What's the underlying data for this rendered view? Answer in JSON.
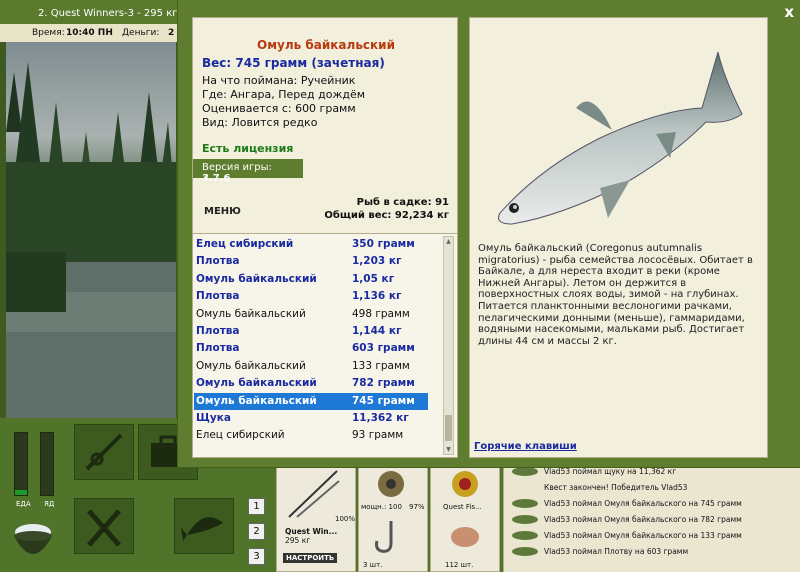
{
  "top_bar": {
    "quest_title": "2. Quest Winners-3 - 295 кг",
    "time_label": "Время:",
    "time_value": "10:40 ПН",
    "money_label": "Деньги:",
    "money_value": "2"
  },
  "gauges": {
    "food_label": "ЕДА",
    "food_level": 0.08,
    "poison_label": "ЯД",
    "poison_level": 0.0
  },
  "side_buttons": [
    "1",
    "2",
    "3"
  ],
  "tackle": {
    "rod_name": "Quest Win...",
    "rod_weight": "295 кг",
    "rod_condition": "100%",
    "reel_label": "мощн.: 100",
    "reel_condition": "97%",
    "line_label": "Quest Fis...",
    "setup_button": "НАСТРОИТЬ",
    "hook_count": "3 шт.",
    "bait_count": "112 шт."
  },
  "chat_log": [
    "Vlad53 поймал щуку на 11,362 кг",
    "Квест закончен! Победитель Vlad53",
    "Vlad53 поймал Омуля байкальского на 745 грамм",
    "Vlad53 поймал Омуля байкальского на 782 грамм",
    "Vlad53 поймал Омуля байкальского на 133 грамм",
    "Vlad53 поймал Плотву на 603 грамм"
  ],
  "dialog": {
    "close_label": "x",
    "fish_name": "Омуль байкальский",
    "weight_line": "Вес: 745 грамм (зачетная)",
    "caught_on": "На что поймана: Ручейник",
    "location": "Где: Ангара, Перед дождём",
    "value": "Оценивается с: 600 грамм",
    "kind": "Вид: Ловится редко",
    "license": "Есть лицензия",
    "version_label": "Версия игры: ",
    "version_value": "3.7.6",
    "menu_label": "МЕНЮ",
    "keepnet_count": "Рыб в садке: 91",
    "total_weight": "Общий вес: 92,234 кг",
    "description": "Омуль байкальский (Coregonus autumnalis migratorius) - рыба семейства лососёвых. Обитает в Байкале, а для нереста входит в реки (кроме Нижней Ангары). Летом он держится в поверхностных слоях воды, зимой - на глубинах. Питается планктонными веслоногими рачками, пелагическими донными (меньше), гаммаридами, водяными насекомыми, мальками рыб. Достигает длины 44 см и массы 2 кг.",
    "hotkeys_link": "Горячие клавиши"
  },
  "catch_list": [
    {
      "name": "Елец сибирский",
      "weight": "350 грамм",
      "style": "bold"
    },
    {
      "name": "Плотва",
      "weight": "1,203 кг",
      "style": "bold"
    },
    {
      "name": "Омуль байкальский",
      "weight": "1,05 кг",
      "style": "bold"
    },
    {
      "name": "Плотва",
      "weight": "1,136 кг",
      "style": "bold"
    },
    {
      "name": "Омуль байкальский",
      "weight": "498 грамм",
      "style": "normal"
    },
    {
      "name": "Плотва",
      "weight": "1,144 кг",
      "style": "bold"
    },
    {
      "name": "Плотва",
      "weight": "603 грамм",
      "style": "bold"
    },
    {
      "name": "Омуль байкальский",
      "weight": "133 грамм",
      "style": "normal"
    },
    {
      "name": "Омуль байкальский",
      "weight": "782 грамм",
      "style": "bold"
    },
    {
      "name": "Омуль байкальский",
      "weight": "745 грамм",
      "style": "selected"
    },
    {
      "name": "Щука",
      "weight": "11,362 кг",
      "style": "bold"
    },
    {
      "name": "Елец сибирский",
      "weight": "93 грамм",
      "style": "normal"
    }
  ]
}
